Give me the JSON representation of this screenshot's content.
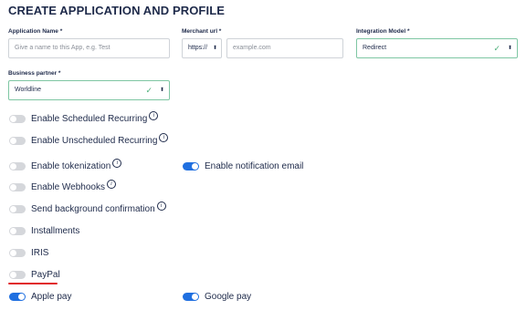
{
  "page_title": "CREATE APPLICATION AND PROFILE",
  "form": {
    "application_name": {
      "label": "Application Name *",
      "placeholder": "Give a name to this App, e.g. Test"
    },
    "merchant_url": {
      "label": "Merchant url *",
      "protocol": "https://",
      "placeholder": "example.com"
    },
    "integration_model": {
      "label": "Integration Model *",
      "value": "Redirect"
    },
    "business_partner": {
      "label": "Business partner *",
      "value": "Worldline"
    }
  },
  "toggles": {
    "scheduled_recurring": {
      "label": "Enable Scheduled Recurring",
      "on": false
    },
    "unscheduled_recurring": {
      "label": "Enable Unscheduled Recurring",
      "on": false
    },
    "tokenization": {
      "label": "Enable tokenization",
      "on": false
    },
    "notification_email": {
      "label": "Enable notification email",
      "on": true
    },
    "webhooks": {
      "label": "Enable Webhooks",
      "on": false
    },
    "background_confirmation": {
      "label": "Send background confirmation",
      "on": false
    },
    "installments": {
      "label": "Installments",
      "on": false
    },
    "iris": {
      "label": "IRIS",
      "on": false
    },
    "paypal": {
      "label": "PayPal",
      "on": false
    },
    "apple_pay": {
      "label": "Apple pay",
      "on": true
    },
    "google_pay": {
      "label": "Google pay",
      "on": true
    }
  },
  "icons": {
    "info": "info-icon",
    "check": "check-icon",
    "caret": "sort-caret-icon"
  },
  "glyphs": {
    "info": "i",
    "check": "✓",
    "caret": "⬍"
  },
  "colors": {
    "accent": "#1f6fe0",
    "valid": "#4caf79",
    "highlight": "#e0232b"
  }
}
